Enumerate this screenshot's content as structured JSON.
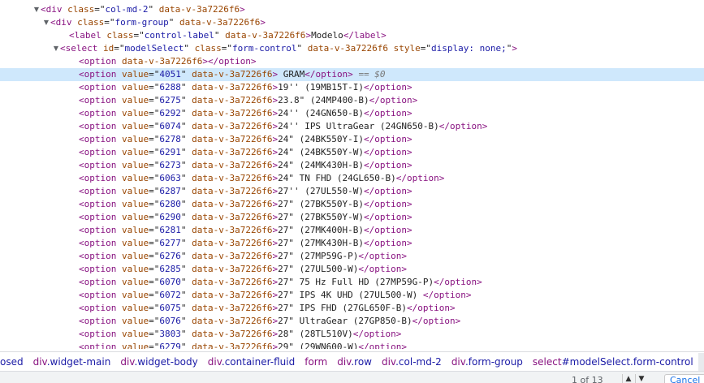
{
  "tree": {
    "nodes": [
      {
        "kind": "open",
        "depth": 0,
        "expanded": true,
        "tag": "div",
        "attrs": [
          {
            "name": "class",
            "value": "col-md-2"
          },
          {
            "name": "data-v-3a7226f6",
            "value": null
          }
        ]
      },
      {
        "kind": "open",
        "depth": 1,
        "expanded": true,
        "tag": "div",
        "attrs": [
          {
            "name": "class",
            "value": "form-group"
          },
          {
            "name": "data-v-3a7226f6",
            "value": null
          }
        ]
      },
      {
        "kind": "element",
        "depth": 2,
        "tag": "label",
        "attrs": [
          {
            "name": "class",
            "value": "control-label"
          },
          {
            "name": "data-v-3a7226f6",
            "value": null
          }
        ],
        "text": "Modelo"
      },
      {
        "kind": "open",
        "depth": 2,
        "expanded": true,
        "tag": "select",
        "attrs": [
          {
            "name": "id",
            "value": "modelSelect"
          },
          {
            "name": "class",
            "value": "form-control"
          },
          {
            "name": "data-v-3a7226f6",
            "value": null
          },
          {
            "name": "style",
            "value": "display: none;"
          }
        ]
      },
      {
        "kind": "element",
        "depth": 3,
        "tag": "option",
        "attrs": [
          {
            "name": "data-v-3a7226f6",
            "value": null
          }
        ],
        "text": ""
      },
      {
        "kind": "element",
        "depth": 3,
        "tag": "option",
        "attrs": [
          {
            "name": "value",
            "value": "4051"
          },
          {
            "name": "data-v-3a7226f6",
            "value": null
          }
        ],
        "text": " GRAM",
        "selected": true,
        "suffix": "== $0"
      },
      {
        "kind": "element",
        "depth": 3,
        "tag": "option",
        "attrs": [
          {
            "name": "value",
            "value": "6288"
          },
          {
            "name": "data-v-3a7226f6",
            "value": null
          }
        ],
        "text": "19'' (19MB15T-I)"
      },
      {
        "kind": "element",
        "depth": 3,
        "tag": "option",
        "attrs": [
          {
            "name": "value",
            "value": "6275"
          },
          {
            "name": "data-v-3a7226f6",
            "value": null
          }
        ],
        "text": "23.8\" (24MP400-B)"
      },
      {
        "kind": "element",
        "depth": 3,
        "tag": "option",
        "attrs": [
          {
            "name": "value",
            "value": "6292"
          },
          {
            "name": "data-v-3a7226f6",
            "value": null
          }
        ],
        "text": "24'' (24GN650-B)"
      },
      {
        "kind": "element",
        "depth": 3,
        "tag": "option",
        "attrs": [
          {
            "name": "value",
            "value": "6074"
          },
          {
            "name": "data-v-3a7226f6",
            "value": null
          }
        ],
        "text": "24'' IPS UltraGear (24GN650-B)"
      },
      {
        "kind": "element",
        "depth": 3,
        "tag": "option",
        "attrs": [
          {
            "name": "value",
            "value": "6278"
          },
          {
            "name": "data-v-3a7226f6",
            "value": null
          }
        ],
        "text": "24\" (24BK550Y-I)"
      },
      {
        "kind": "element",
        "depth": 3,
        "tag": "option",
        "attrs": [
          {
            "name": "value",
            "value": "6291"
          },
          {
            "name": "data-v-3a7226f6",
            "value": null
          }
        ],
        "text": "24\" (24BK550Y-W)"
      },
      {
        "kind": "element",
        "depth": 3,
        "tag": "option",
        "attrs": [
          {
            "name": "value",
            "value": "6273"
          },
          {
            "name": "data-v-3a7226f6",
            "value": null
          }
        ],
        "text": "24\" (24MK430H-B)"
      },
      {
        "kind": "element",
        "depth": 3,
        "tag": "option",
        "attrs": [
          {
            "name": "value",
            "value": "6063"
          },
          {
            "name": "data-v-3a7226f6",
            "value": null
          }
        ],
        "text": "24\" TN FHD (24GL650-B)"
      },
      {
        "kind": "element",
        "depth": 3,
        "tag": "option",
        "attrs": [
          {
            "name": "value",
            "value": "6287"
          },
          {
            "name": "data-v-3a7226f6",
            "value": null
          }
        ],
        "text": "27'' (27UL550-W)"
      },
      {
        "kind": "element",
        "depth": 3,
        "tag": "option",
        "attrs": [
          {
            "name": "value",
            "value": "6280"
          },
          {
            "name": "data-v-3a7226f6",
            "value": null
          }
        ],
        "text": "27\" (27BK550Y-B)"
      },
      {
        "kind": "element",
        "depth": 3,
        "tag": "option",
        "attrs": [
          {
            "name": "value",
            "value": "6290"
          },
          {
            "name": "data-v-3a7226f6",
            "value": null
          }
        ],
        "text": "27\" (27BK550Y-W)"
      },
      {
        "kind": "element",
        "depth": 3,
        "tag": "option",
        "attrs": [
          {
            "name": "value",
            "value": "6281"
          },
          {
            "name": "data-v-3a7226f6",
            "value": null
          }
        ],
        "text": "27\" (27MK400H-B)"
      },
      {
        "kind": "element",
        "depth": 3,
        "tag": "option",
        "attrs": [
          {
            "name": "value",
            "value": "6277"
          },
          {
            "name": "data-v-3a7226f6",
            "value": null
          }
        ],
        "text": "27\" (27MK430H-B)"
      },
      {
        "kind": "element",
        "depth": 3,
        "tag": "option",
        "attrs": [
          {
            "name": "value",
            "value": "6276"
          },
          {
            "name": "data-v-3a7226f6",
            "value": null
          }
        ],
        "text": "27\" (27MP59G-P)"
      },
      {
        "kind": "element",
        "depth": 3,
        "tag": "option",
        "attrs": [
          {
            "name": "value",
            "value": "6285"
          },
          {
            "name": "data-v-3a7226f6",
            "value": null
          }
        ],
        "text": "27\" (27UL500-W)"
      },
      {
        "kind": "element",
        "depth": 3,
        "tag": "option",
        "attrs": [
          {
            "name": "value",
            "value": "6070"
          },
          {
            "name": "data-v-3a7226f6",
            "value": null
          }
        ],
        "text": "27\" 75 Hz Full HD (27MP59G-P)"
      },
      {
        "kind": "element",
        "depth": 3,
        "tag": "option",
        "attrs": [
          {
            "name": "value",
            "value": "6072"
          },
          {
            "name": "data-v-3a7226f6",
            "value": null
          }
        ],
        "text": "27\" IPS 4K UHD (27UL500-W) "
      },
      {
        "kind": "element",
        "depth": 3,
        "tag": "option",
        "attrs": [
          {
            "name": "value",
            "value": "6075"
          },
          {
            "name": "data-v-3a7226f6",
            "value": null
          }
        ],
        "text": "27\" IPS FHD (27GL650F-B)"
      },
      {
        "kind": "element",
        "depth": 3,
        "tag": "option",
        "attrs": [
          {
            "name": "value",
            "value": "6076"
          },
          {
            "name": "data-v-3a7226f6",
            "value": null
          }
        ],
        "text": "27\" UltraGear (27GP850-B)"
      },
      {
        "kind": "element",
        "depth": 3,
        "tag": "option",
        "attrs": [
          {
            "name": "value",
            "value": "3803"
          },
          {
            "name": "data-v-3a7226f6",
            "value": null
          }
        ],
        "text": "28\" (28TL510V)"
      },
      {
        "kind": "element",
        "depth": 3,
        "tag": "option",
        "attrs": [
          {
            "name": "value",
            "value": "6279"
          },
          {
            "name": "data-v-3a7226f6",
            "value": null
          }
        ],
        "text": "29\" (29WN600-W)"
      }
    ]
  },
  "breadcrumb": [
    {
      "tag": "",
      "cls": "osed"
    },
    {
      "tag": "div",
      "cls": ".widget-main"
    },
    {
      "tag": "div",
      "cls": ".widget-body"
    },
    {
      "tag": "div",
      "cls": ".container-fluid"
    },
    {
      "tag": "form",
      "cls": ""
    },
    {
      "tag": "div",
      "cls": ".row"
    },
    {
      "tag": "div",
      "cls": ".col-md-2"
    },
    {
      "tag": "div",
      "cls": ".form-group"
    },
    {
      "tag": "select",
      "cls": "#modelSelect.form-control"
    },
    {
      "tag": "option",
      "cls": "",
      "active": true
    }
  ],
  "findbar": {
    "count": "1 of 13",
    "cancel": "Cancel"
  },
  "colors": {
    "tag": "#881280",
    "attr_name": "#994500",
    "attr_value": "#1a1aa6",
    "selected_row": "#cfe8fc"
  }
}
